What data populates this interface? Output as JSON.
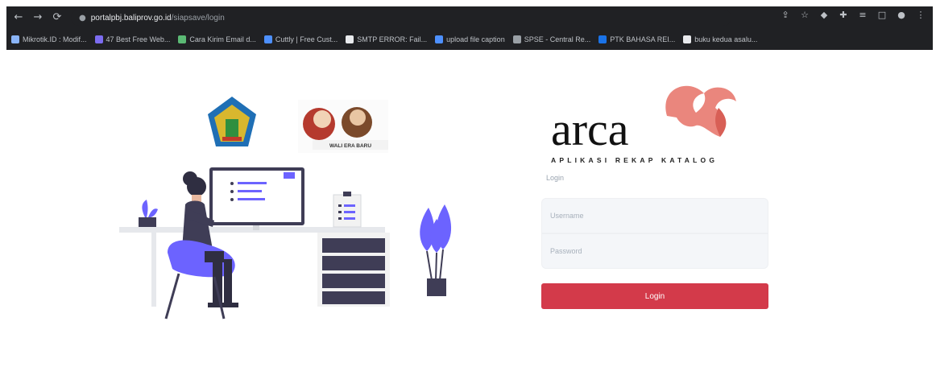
{
  "browser": {
    "url_host": "portalpbj.baliprov.go.id",
    "url_path": "/siapsave/login",
    "nav": {
      "back": "←",
      "forward": "→",
      "reload": "⟳"
    },
    "bookmarks": [
      {
        "label": "Mikrotik.ID : Modif...",
        "color": "#8ab4f8"
      },
      {
        "label": "47 Best Free Web...",
        "color": "#7c6cf0"
      },
      {
        "label": "Cara Kirim Email d...",
        "color": "#5bb974"
      },
      {
        "label": "Cuttly | Free Cust...",
        "color": "#4d90fe"
      },
      {
        "label": "SMTP ERROR: Fail...",
        "color": "#e8eaed"
      },
      {
        "label": "upload file caption",
        "color": "#4d90fe"
      },
      {
        "label": "SPSE - Central Re...",
        "color": "#9aa0a6"
      },
      {
        "label": "PTK BAHASA REI...",
        "color": "#1a73e8"
      },
      {
        "label": "buku kedua asalu...",
        "color": "#e8eaed"
      }
    ]
  },
  "brand": {
    "logo_text": "arca",
    "tagline": "APLIKASI REKAP KATALOG",
    "accent_color": "#e8796f"
  },
  "illustration": {
    "emblem_text": "WALI ERA BARU"
  },
  "login": {
    "caption": "Login",
    "username_placeholder": "Username",
    "password_placeholder": "Password",
    "button_label": "Login",
    "button_color": "#d33a4a"
  }
}
